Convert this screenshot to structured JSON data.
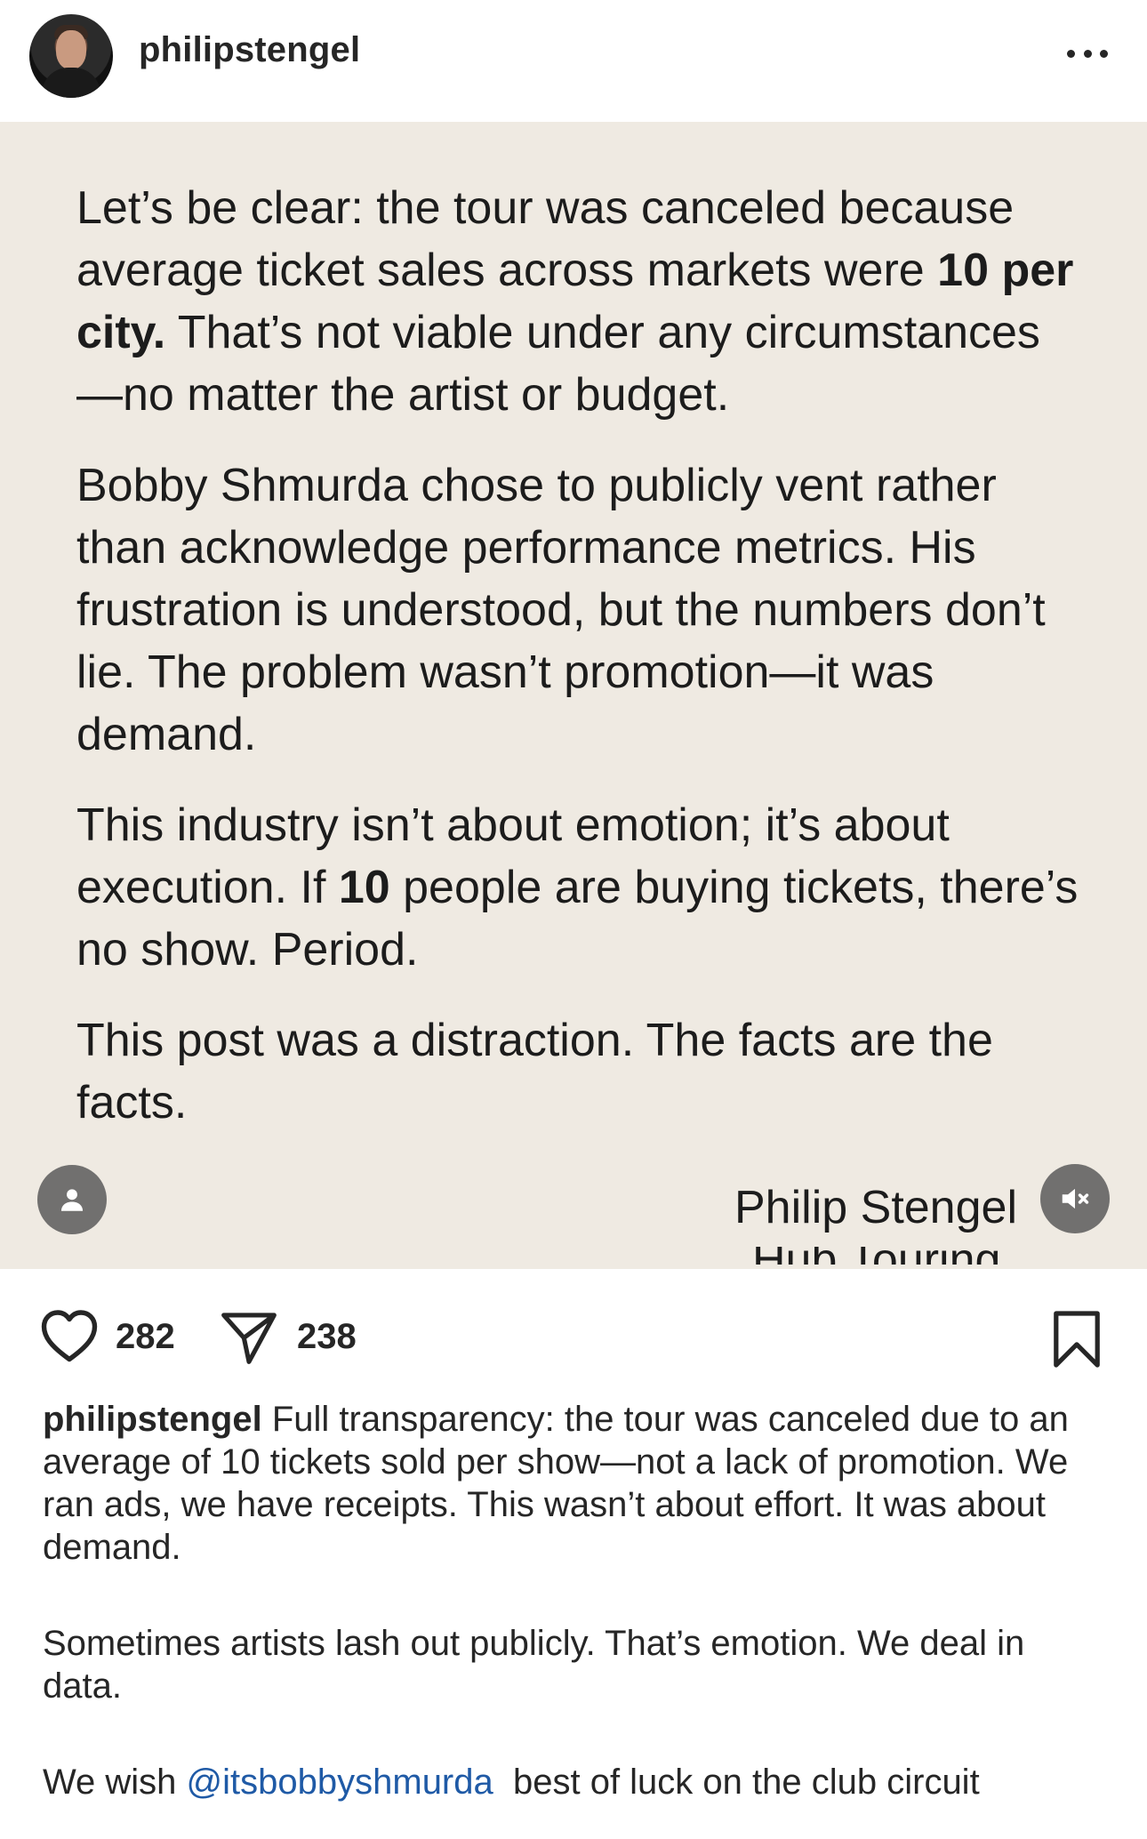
{
  "post": {
    "username": "philipstengel",
    "avatar_icon": "profile-photo"
  },
  "media": {
    "paragraphs": [
      {
        "parts": [
          {
            "text": "Let’s be clear: the tour was canceled because average ticket sales across markets were ",
            "bold": false
          },
          {
            "text": "10 per city.",
            "bold": true
          },
          {
            "text": " That’s not viable under any circumstances—no matter the artist or budget.",
            "bold": false
          }
        ]
      },
      {
        "parts": [
          {
            "text": "Bobby Shmurda chose to publicly vent rather than acknowledge performance metrics. His frustration is understood, but the numbers don’t lie. The problem wasn’t promotion—it was demand.",
            "bold": false
          }
        ]
      },
      {
        "parts": [
          {
            "text": "This industry isn’t about emotion; it’s about execution. If ",
            "bold": false
          },
          {
            "text": "10",
            "bold": true
          },
          {
            "text": " people are buying tickets, there’s no show. Period.",
            "bold": false
          }
        ]
      },
      {
        "parts": [
          {
            "text": "This post was a distraction. The facts are the facts.",
            "bold": false
          }
        ]
      }
    ],
    "signature": "Philip Stengel",
    "signature_sub": "Hub Touring"
  },
  "actions": {
    "like_count": "282",
    "share_count": "238"
  },
  "caption": {
    "handle": "philipstengel",
    "para1": "Full transparency: the tour was canceled due to an average of 10 tickets sold per show—not a lack of promotion. We ran ads, we have receipts. This wasn’t about effort. It was about demand.",
    "para2": "Sometimes artists lash out publicly. That’s emotion. We deal in data.",
    "para3_prefix": "We wish ",
    "mention": "@itsbobbyshmurda",
    "para3_suffix": "  best of luck on the club circuit"
  },
  "colors": {
    "media_bg": "#efeae2",
    "mention": "#1f5aa6"
  }
}
